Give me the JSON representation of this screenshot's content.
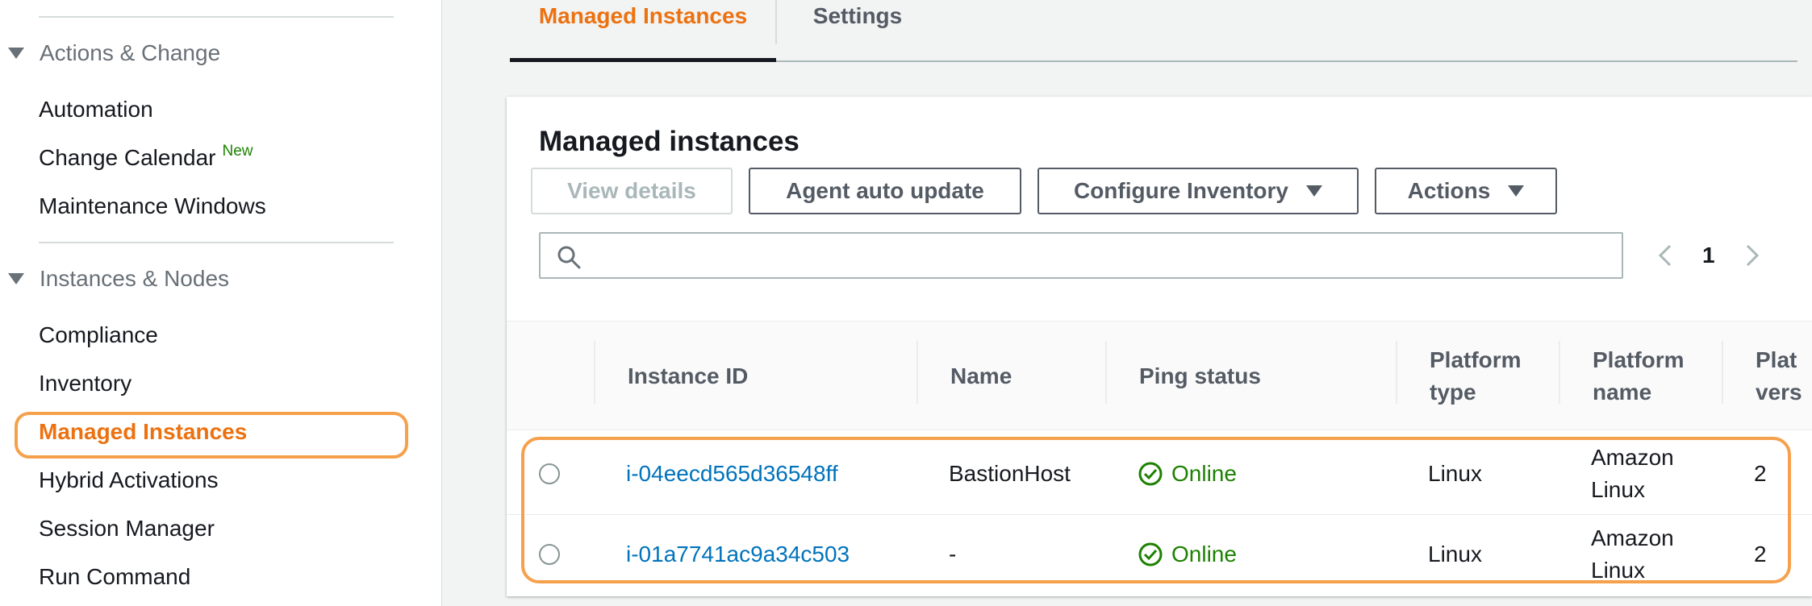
{
  "sidebar": {
    "sections": [
      {
        "title": "Actions & Change",
        "items": [
          {
            "label": "Automation"
          },
          {
            "label": "Change Calendar",
            "badge": "New"
          },
          {
            "label": "Maintenance Windows"
          }
        ]
      },
      {
        "title": "Instances & Nodes",
        "items": [
          {
            "label": "Compliance"
          },
          {
            "label": "Inventory"
          },
          {
            "label": "Managed Instances",
            "active": true
          },
          {
            "label": "Hybrid Activations"
          },
          {
            "label": "Session Manager"
          },
          {
            "label": "Run Command"
          }
        ]
      }
    ]
  },
  "tabs": [
    {
      "label": "Managed Instances",
      "active": true
    },
    {
      "label": "Settings",
      "active": false
    }
  ],
  "panel": {
    "title": "Managed instances",
    "buttons": {
      "view_details": "View details",
      "agent_auto_update": "Agent auto update",
      "configure_inventory": "Configure Inventory",
      "actions": "Actions"
    },
    "search": {
      "placeholder": "",
      "value": ""
    },
    "pagination": {
      "current_page": "1"
    }
  },
  "table": {
    "columns": [
      {
        "label": "Instance ID"
      },
      {
        "label": "Name"
      },
      {
        "label": "Ping status"
      },
      {
        "label": "Platform type"
      },
      {
        "label": "Platform name"
      },
      {
        "label": "Plat vers"
      }
    ],
    "rows": [
      {
        "instance_id": "i-04eecd565d36548ff",
        "name": "BastionHost",
        "ping_status": "Online",
        "platform_type": "Linux",
        "platform_name": "Amazon Linux",
        "platform_version": "2"
      },
      {
        "instance_id": "i-01a7741ac9a34c503",
        "name": "-",
        "ping_status": "Online",
        "platform_type": "Linux",
        "platform_name": "Amazon Linux",
        "platform_version": "2"
      }
    ]
  },
  "colors": {
    "accent": "#ec7211",
    "highlight_ring": "#f5a14c",
    "link": "#0073bb",
    "success": "#1d8102"
  },
  "icons": {
    "search": "search-icon",
    "online": "check-circle-icon",
    "caret": "caret-down-icon",
    "prev": "chevron-left-icon",
    "next": "chevron-right-icon"
  }
}
